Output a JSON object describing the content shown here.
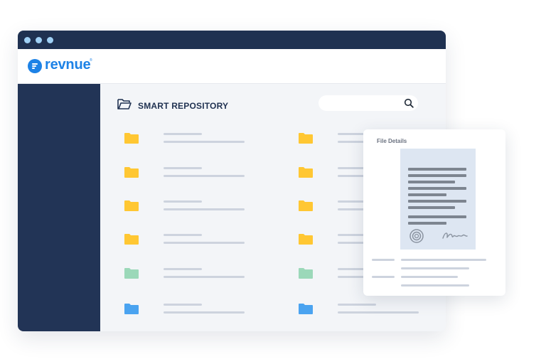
{
  "app": {
    "logo_text": "revnue",
    "logo_tm": "®"
  },
  "repository": {
    "title": "SMART REPOSITORY",
    "search_placeholder": ""
  },
  "folders": [
    {
      "column": 1,
      "color": "#ffc733"
    },
    {
      "column": 1,
      "color": "#ffc733"
    },
    {
      "column": 1,
      "color": "#ffc733"
    },
    {
      "column": 1,
      "color": "#ffc733"
    },
    {
      "column": 1,
      "color": "#9bd8b9"
    },
    {
      "column": 1,
      "color": "#4aa3f0"
    },
    {
      "column": 2,
      "color": "#ffc733"
    },
    {
      "column": 2,
      "color": "#ffc733"
    },
    {
      "column": 2,
      "color": "#ffc733"
    },
    {
      "column": 2,
      "color": "#ffc733"
    },
    {
      "column": 2,
      "color": "#9bd8b9"
    },
    {
      "column": 2,
      "color": "#4aa3f0"
    }
  ],
  "file_details": {
    "title": "File Details"
  },
  "colors": {
    "titlebar": "#1f3151",
    "sidebar": "#223456",
    "brand": "#1d82e6"
  }
}
